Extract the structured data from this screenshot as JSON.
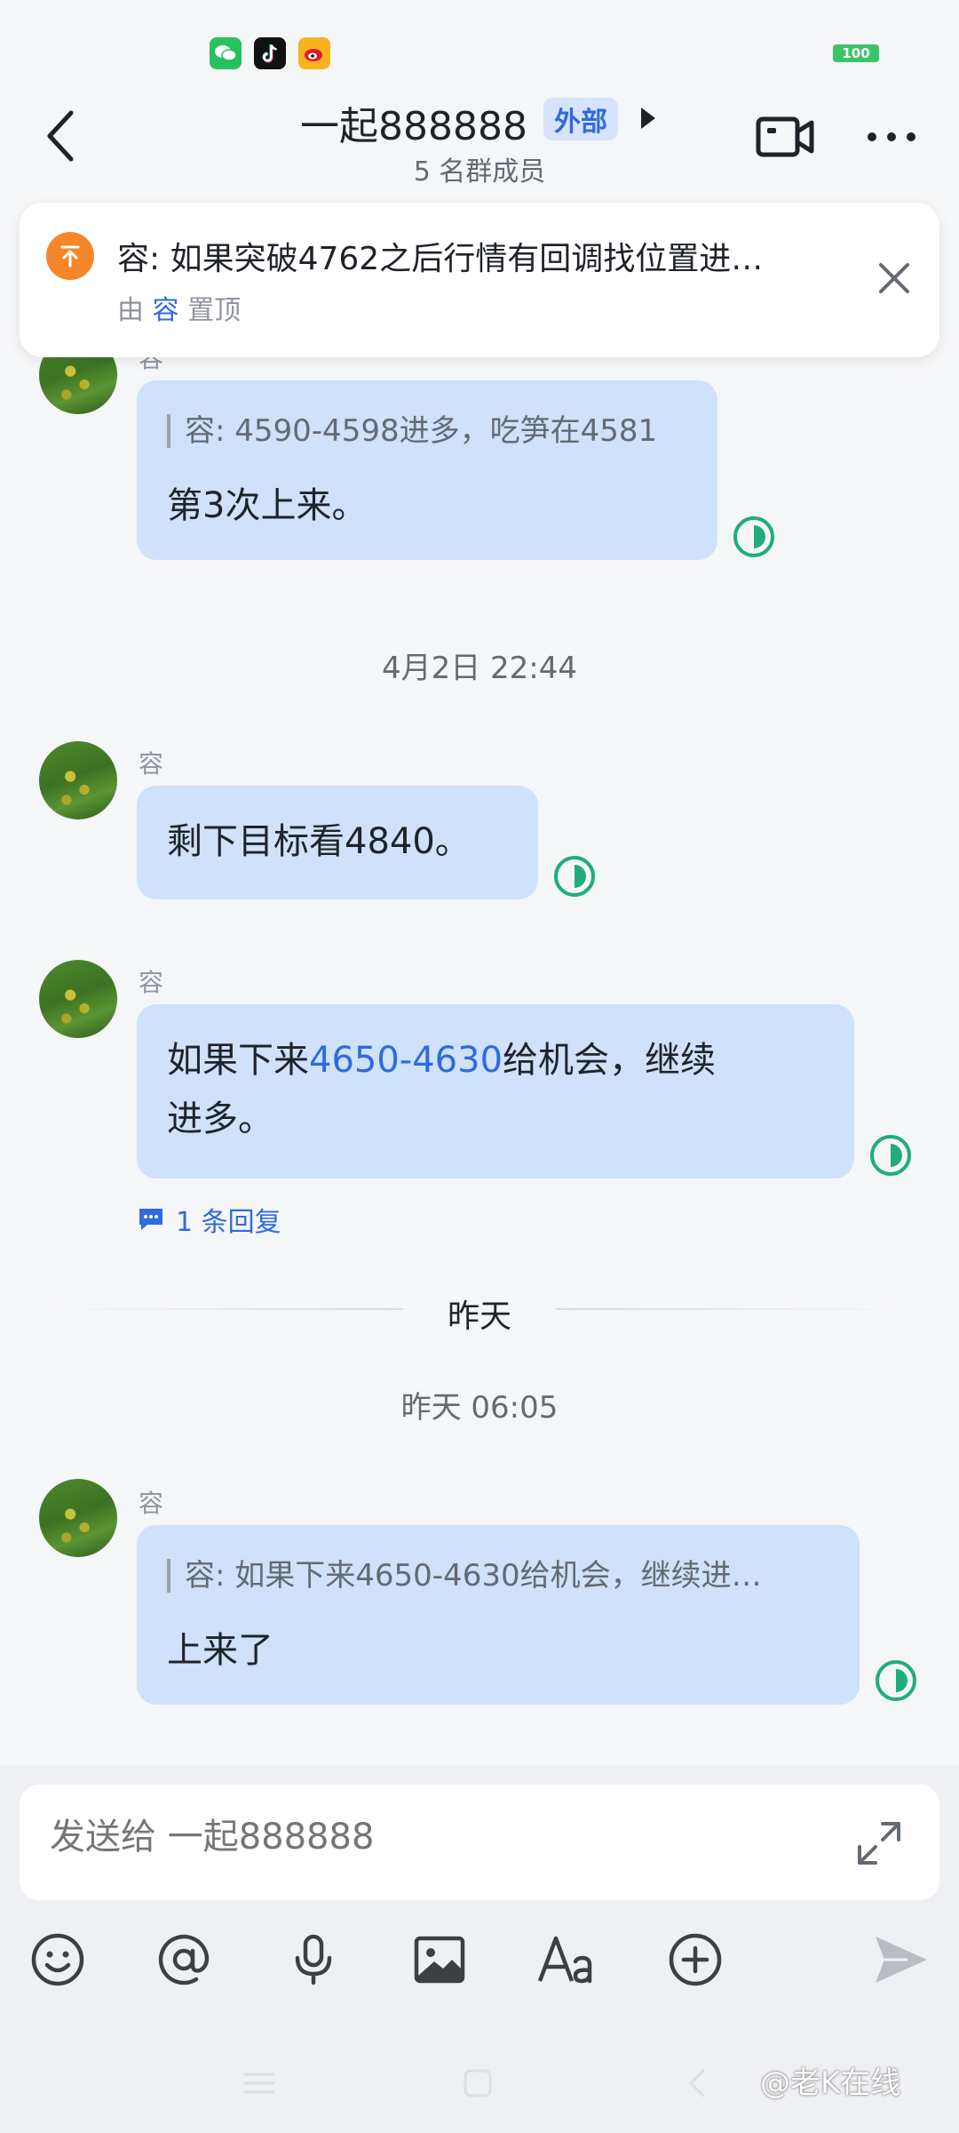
{
  "status_bar": {
    "apps": [
      "wechat-icon",
      "tiktok-icon",
      "weibo-icon"
    ],
    "battery": "100"
  },
  "header": {
    "title": "一起888888",
    "badge": "外部",
    "subtitle": "5 名群成员"
  },
  "pinned": {
    "text": "容: 如果突破4762之后行情有回调找位置进…",
    "by_prefix": "由",
    "by_name": "容",
    "by_suffix": "置顶"
  },
  "messages": [
    {
      "sender": "容",
      "quote": "容: 4590-4598进多，吃笋在4581",
      "text": "第3次上来。"
    },
    {
      "sender": "容",
      "text": "剩下目标看4840。"
    },
    {
      "sender": "容",
      "text_before": "如果下来",
      "link": "4650-4630",
      "text_after_line1": "给机会，继续",
      "text_line2": "进多。",
      "reply_count": "1 条回复"
    },
    {
      "sender": "容",
      "quote": "容: 如果下来4650-4630给机会，继续进…",
      "text": "上来了"
    }
  ],
  "timestamps": {
    "t1": "4月2日 22:44",
    "divider": "昨天",
    "t2": "昨天 06:05"
  },
  "composer": {
    "placeholder": "发送给 一起888888"
  },
  "toolbar": [
    "emoji-icon",
    "mention-icon",
    "microphone-icon",
    "image-icon",
    "text-format-icon",
    "add-icon",
    "send-icon"
  ],
  "watermark": "@老K在线",
  "colors": {
    "accent": "#2f6bde",
    "bubble": "#cfe1fb",
    "read_icon": "#1fae7a",
    "pin": "#f5862a"
  }
}
